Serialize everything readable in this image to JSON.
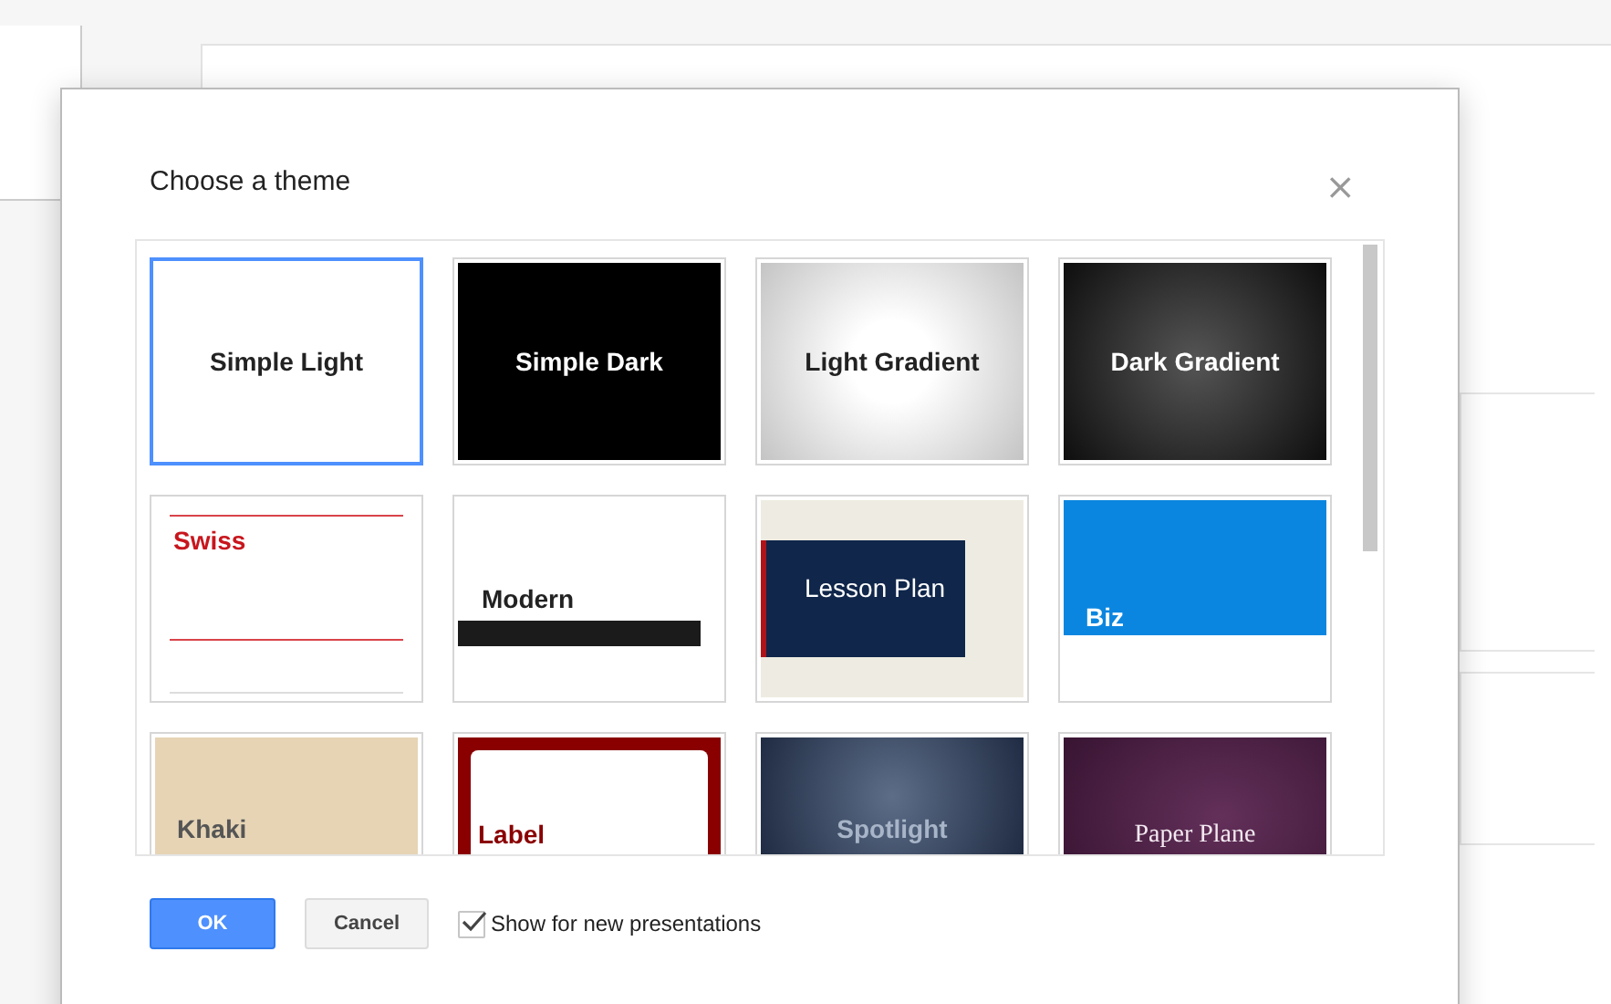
{
  "dialog": {
    "title": "Choose a theme",
    "close": "×"
  },
  "themes": [
    {
      "kind": "simple-light",
      "label": "Simple Light",
      "selected": true
    },
    {
      "kind": "simple-dark",
      "label": "Simple Dark",
      "selected": false
    },
    {
      "kind": "light-gradient",
      "label": "Light Gradient",
      "selected": false
    },
    {
      "kind": "dark-gradient",
      "label": "Dark Gradient",
      "selected": false
    },
    {
      "kind": "swiss",
      "label": "Swiss",
      "selected": false
    },
    {
      "kind": "modern",
      "label": "Modern",
      "selected": false
    },
    {
      "kind": "lesson-plan",
      "label": "Lesson Plan",
      "selected": false
    },
    {
      "kind": "biz",
      "label": "Biz",
      "selected": false
    },
    {
      "kind": "khaki",
      "label": "Khaki",
      "selected": false
    },
    {
      "kind": "label",
      "label": "Label",
      "selected": false
    },
    {
      "kind": "spotlight",
      "label": "Spotlight",
      "selected": false
    },
    {
      "kind": "paper-plane",
      "label": "Paper Plane",
      "selected": false
    }
  ],
  "buttons": [
    {
      "kind": "primary",
      "label": "OK"
    },
    {
      "kind": "secondary",
      "label": "Cancel"
    }
  ],
  "show_for_new": {
    "label": "Show for new presentations",
    "checked": true
  }
}
